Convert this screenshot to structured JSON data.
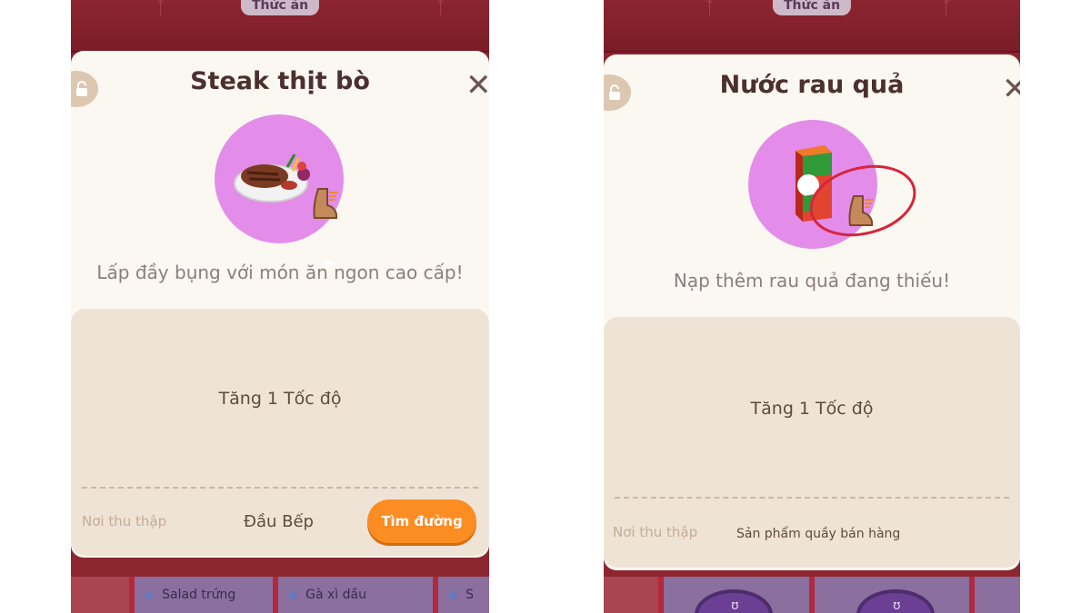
{
  "screens": [
    {
      "top_tab_label": "Thức ăn",
      "item_title": "Steak thịt bò",
      "item_icon": "steak-plate-icon",
      "badge_icon": "speed-boot-icon",
      "description": "Lấp đầy bụng với món ăn ngon cao cấp!",
      "effect": "Tăng 1 Tốc độ",
      "source_label": "Nơi thu thập",
      "source_value": "Đầu Bếp",
      "find_button_label": "Tìm đường",
      "bottom_items": [
        "Salad trứng",
        "Gà xì dầu",
        "S"
      ]
    },
    {
      "top_tab_label": "Thức ăn",
      "item_title": "Nước rau quả",
      "item_icon": "juice-box-icon",
      "badge_icon": "speed-boot-icon",
      "description": "Nạp thêm rau quả đang thiếu!",
      "effect": "Tăng 1 Tốc độ",
      "source_label": "Nơi thu thập",
      "source_value": "Sản phẩm quầy bán hàng",
      "bottom_items": [
        "ʊ",
        "ʊ"
      ]
    }
  ],
  "colors": {
    "header_red": "#8c2530",
    "sheet_bg": "#fbf7f1",
    "item_circle": "#e38ce9",
    "info_box": "#efe3d6",
    "button_orange": "#fb8d23",
    "annotation_red": "#d8243a"
  }
}
